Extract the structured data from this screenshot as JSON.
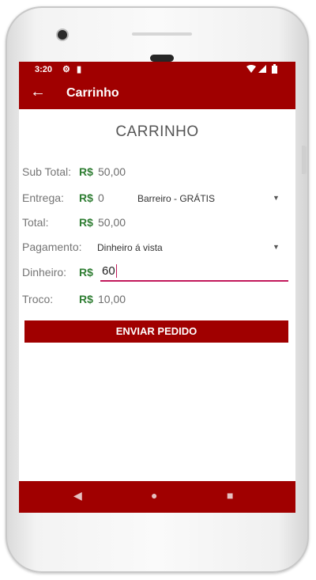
{
  "status_bar": {
    "time": "3:20",
    "left_icons": [
      "gear-icon",
      "sd-card-icon"
    ],
    "right_icons": [
      "wifi-icon",
      "signal-icon",
      "battery-icon"
    ]
  },
  "app_bar": {
    "title": "Carrinho",
    "back_icon": "arrow-left-icon"
  },
  "page": {
    "heading": "CARRINHO"
  },
  "rows": {
    "subtotal": {
      "label": "Sub Total:",
      "currency": "R$",
      "value": "50,00"
    },
    "entrega": {
      "label": "Entrega:",
      "currency": "R$",
      "value": "0",
      "option": "Barreiro - GRÁTIS"
    },
    "total": {
      "label": "Total:",
      "currency": "R$",
      "value": "50,00"
    },
    "pagamento": {
      "label": "Pagamento:",
      "option": "Dinheiro á vista"
    },
    "dinheiro": {
      "label": "Dinheiro:",
      "currency": "R$",
      "input_value": "60"
    },
    "troco": {
      "label": "Troco:",
      "currency": "R$",
      "value": "10,00"
    }
  },
  "actions": {
    "submit_label": "ENVIAR PEDIDO"
  },
  "nav": {
    "back": "◀",
    "home": "●",
    "recents": "■"
  },
  "colors": {
    "primary": "#a00000",
    "currency": "#2e7d32",
    "input_accent": "#c2185b"
  }
}
